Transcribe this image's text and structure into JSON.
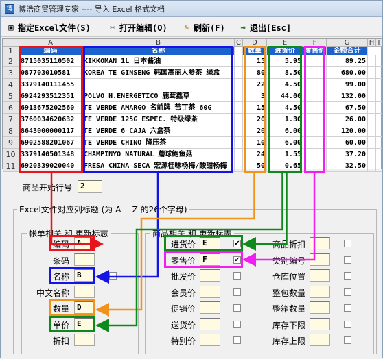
{
  "window": {
    "title": "博浩商贸管理专家 ---- 导入 Excel 格式文档",
    "app_icon": "app-icon"
  },
  "toolbar": {
    "open_excel": "指定Excel文件(S)",
    "open_edit": "打开编辑(O)",
    "refresh": "刷新(F)",
    "exit": "退出[Esc]"
  },
  "sheet": {
    "columns": [
      "A",
      "B",
      "C",
      "D",
      "E",
      "F",
      "G",
      "H",
      "I"
    ],
    "header_row": [
      "编码",
      "名称",
      "",
      "数量",
      "进货价",
      "零售价",
      "金额合计"
    ],
    "row_numbers": [
      "1",
      "2",
      "3",
      "4",
      "5",
      "6",
      "7",
      "8",
      "9",
      "10",
      "11"
    ],
    "rows": [
      [
        "8715035110502",
        "KIKKOMAN 1L 日本酱油",
        "15",
        "5.95",
        "89.25"
      ],
      [
        "087703010581",
        "KOREA TE GINSENG 韩国高丽人参茶 绿盒",
        "80",
        "8.50",
        "680.00"
      ],
      [
        "3379140111455",
        "",
        "22",
        "4.50",
        "99.00"
      ],
      [
        "6924293512351",
        "POLVO H.ENERGETICO 鹿茸鑫草",
        "3",
        "44.00",
        "132.00"
      ],
      [
        "6913675202560",
        "TE VERDE AMARGO 名前牌 苦丁茶 60G",
        "15",
        "4.50",
        "67.50"
      ],
      [
        "3760034620632",
        "TE VERDE 125G ESPEC. 特级绿茶",
        "20",
        "1.30",
        "26.00"
      ],
      [
        "8643000000117",
        "TE VERDE 6 CAJA 六盒茶",
        "20",
        "6.00",
        "120.00"
      ],
      [
        "6902588201067",
        "TE VERDE CHINO 降压茶",
        "10",
        "6.00",
        "60.00"
      ],
      [
        "3379140501348",
        "CHAMPINYO NATURAL 蘑球鲍鱼菇",
        "24",
        "1.55",
        "37.20"
      ],
      [
        "6920339020040",
        "FRESA CHINA SECA 宏源桂味杨梅/酸甜杨梅",
        "50",
        "0.65",
        "32.50"
      ]
    ]
  },
  "start_row": {
    "label": "商品开始行号",
    "value": "2"
  },
  "mapping": {
    "title": "Excel文件对应列标题 (为 A -- Z 的26个字母)",
    "bill": {
      "title": "帐单相关  和  更新标志",
      "fields": [
        {
          "label": "编码",
          "value": "A"
        },
        {
          "label": "条码",
          "value": ""
        },
        {
          "label": "名称",
          "value": "B"
        },
        {
          "label": "中文名称",
          "value": ""
        },
        {
          "label": "数量",
          "value": "D"
        },
        {
          "label": "单价",
          "value": "E"
        },
        {
          "label": "折扣",
          "value": ""
        }
      ]
    },
    "product": {
      "title": "商品相关  和  更新标志",
      "left": [
        {
          "label": "进货价",
          "value": "E",
          "checked": "✔"
        },
        {
          "label": "零售价",
          "value": "F",
          "checked": "✔"
        },
        {
          "label": "批发价",
          "value": ""
        },
        {
          "label": "会员价",
          "value": ""
        },
        {
          "label": "促销价",
          "value": ""
        },
        {
          "label": "送货价",
          "value": ""
        },
        {
          "label": "特别价",
          "value": ""
        }
      ],
      "right": [
        {
          "label": "商品折扣",
          "value": ""
        },
        {
          "label": "类别编号",
          "value": ""
        },
        {
          "label": "仓库位置",
          "value": ""
        },
        {
          "label": "整包数量",
          "value": ""
        },
        {
          "label": "整箱数量",
          "value": ""
        },
        {
          "label": "库存下限",
          "value": ""
        },
        {
          "label": "库存上限",
          "value": ""
        }
      ]
    }
  },
  "colors": {
    "red": "#e8141b",
    "blue": "#1414e6",
    "orange": "#f0921c",
    "green": "#0e8a1c",
    "magenta": "#f01ef0",
    "header_blue": "#1c62cf"
  }
}
